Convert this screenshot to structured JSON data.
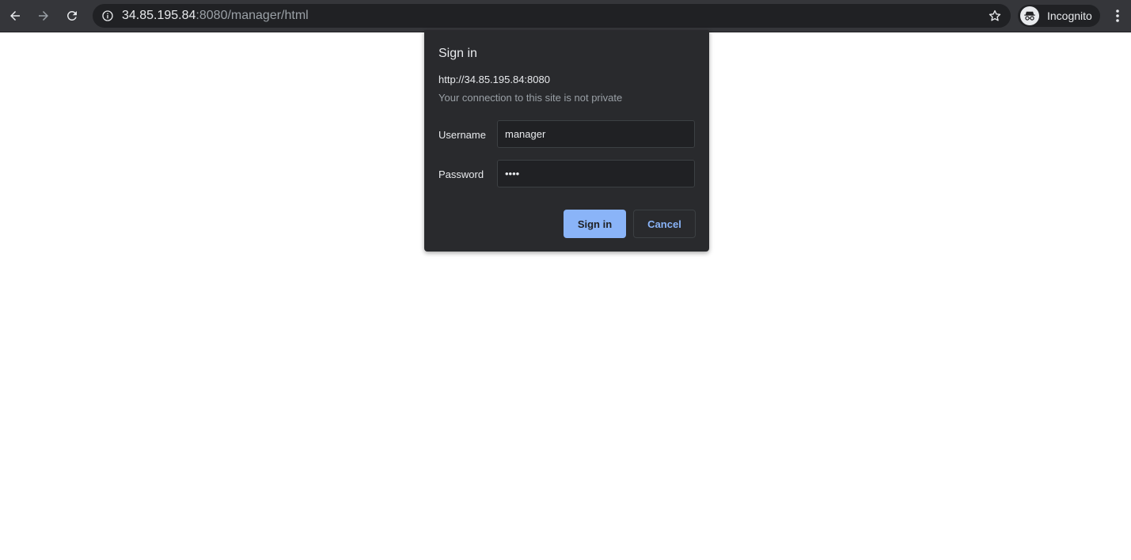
{
  "browser": {
    "url_host": "34.85.195.84",
    "url_rest": ":8080/manager/html",
    "profile_label": "Incognito",
    "icons": {
      "back": "back-arrow-icon",
      "forward": "forward-arrow-icon",
      "reload": "reload-icon",
      "site_info": "info-icon",
      "bookmark": "star-icon",
      "profile": "incognito-icon",
      "menu": "kebab-menu-icon"
    }
  },
  "dialog": {
    "title": "Sign in",
    "origin": "http://34.85.195.84:8080",
    "warning": "Your connection to this site is not private",
    "username_label": "Username",
    "username_value": "manager",
    "password_label": "Password",
    "password_value": "••••",
    "sign_in_label": "Sign in",
    "cancel_label": "Cancel"
  },
  "colors": {
    "toolbar": "#35363a",
    "omnibox": "#202124",
    "dialog_bg": "#292a2d",
    "accent": "#8ab4f8"
  }
}
